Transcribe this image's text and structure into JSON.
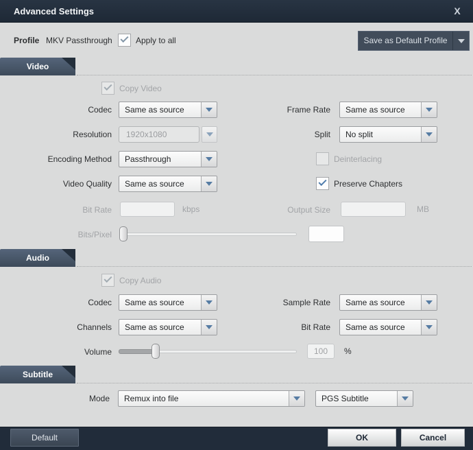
{
  "window": {
    "title": "Advanced Settings",
    "close_glyph": "X"
  },
  "profile": {
    "label": "Profile",
    "value": "MKV Passthrough",
    "apply_to_all_checked": true,
    "apply_to_all_label": "Apply to all",
    "save_default_label": "Save as Default Profile"
  },
  "video": {
    "section_title": "Video",
    "copy_video_label": "Copy Video",
    "copy_video_checked": true,
    "copy_video_disabled": true,
    "codec": {
      "label": "Codec",
      "value": "Same as source"
    },
    "frame_rate": {
      "label": "Frame Rate",
      "value": "Same as source"
    },
    "resolution": {
      "label": "Resolution",
      "value": "1920x1080",
      "disabled": true
    },
    "split": {
      "label": "Split",
      "value": "No split"
    },
    "encoding_method": {
      "label": "Encoding Method",
      "value": "Passthrough"
    },
    "deinterlacing_label": "Deinterlacing",
    "deinterlacing_checked": false,
    "deinterlacing_disabled": true,
    "video_quality": {
      "label": "Video Quality",
      "value": "Same as source"
    },
    "preserve_chapters_label": "Preserve Chapters",
    "preserve_chapters_checked": true,
    "bit_rate": {
      "label": "Bit Rate",
      "value": "",
      "unit": "kbps",
      "disabled": true
    },
    "output_size": {
      "label": "Output Size",
      "value": "",
      "unit": "MB",
      "disabled": true
    },
    "bits_pixel": {
      "label": "Bits/Pixel",
      "value": "",
      "slider_position_percent": 0,
      "disabled": true
    }
  },
  "audio": {
    "section_title": "Audio",
    "copy_audio_label": "Copy Audio",
    "copy_audio_checked": true,
    "copy_audio_disabled": true,
    "codec": {
      "label": "Codec",
      "value": "Same as source"
    },
    "sample_rate": {
      "label": "Sample Rate",
      "value": "Same as source"
    },
    "channels": {
      "label": "Channels",
      "value": "Same as source"
    },
    "bit_rate": {
      "label": "Bit Rate",
      "value": "Same as source"
    },
    "volume": {
      "label": "Volume",
      "value": "100",
      "unit": "%",
      "slider_position_percent": 20
    }
  },
  "subtitle": {
    "section_title": "Subtitle",
    "mode": {
      "label": "Mode",
      "value": "Remux into file"
    },
    "format": {
      "value": "PGS Subtitle"
    }
  },
  "footer": {
    "default_label": "Default",
    "ok_label": "OK",
    "cancel_label": "Cancel"
  },
  "colors": {
    "titlebar": "#212c3a",
    "content_bg": "#dadbdb",
    "section_tab": "#46566a",
    "dropdown_arrow": "#567ca3",
    "check_mark": "#4f7cac",
    "button_dark": "#414c5a",
    "button_light": "#e8e9ea"
  }
}
